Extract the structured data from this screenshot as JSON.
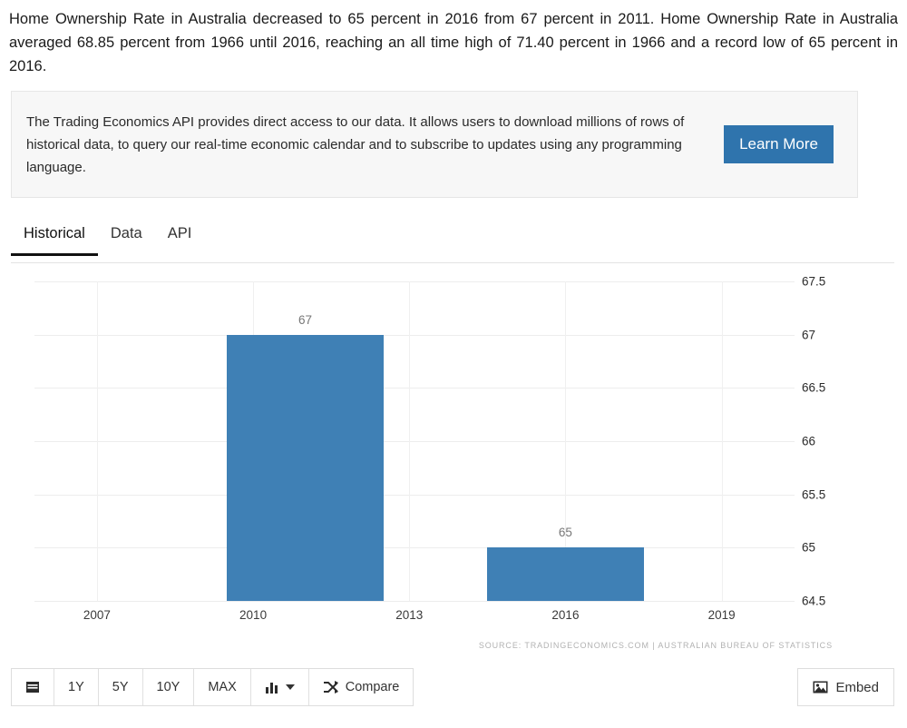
{
  "intro": {
    "paragraph": "Home Ownership Rate in Australia decreased to 65 percent in 2016 from 67 percent in 2011. Home Ownership Rate in Australia averaged 68.85 percent from 1966 until 2016, reaching an all time high of 71.40 percent in 1966 and a record low of 65 percent in 2016."
  },
  "api_card": {
    "text": "The Trading Economics API provides direct access to our data. It allows users to download millions of rows of historical data, to query our real-time economic calendar and to subscribe to updates using any programming language.",
    "button_label": "Learn More",
    "button_color": "#2f74ad"
  },
  "tabs": [
    {
      "label": "Historical",
      "active": true
    },
    {
      "label": "Data",
      "active": false
    },
    {
      "label": "API",
      "active": false
    }
  ],
  "chart_data": {
    "type": "bar",
    "title": "",
    "subtitle": "",
    "xlabel": "",
    "ylabel": "",
    "categories": [
      "2011",
      "2016"
    ],
    "values": [
      67,
      65
    ],
    "data_labels": [
      "67",
      "65"
    ],
    "series": [
      {
        "name": "Home Ownership Rate in Australia",
        "values": [
          67,
          65
        ]
      }
    ],
    "bar_color": "#3f80b5",
    "ylim": [
      64.5,
      67.5
    ],
    "yticks": [
      "67.5",
      "67",
      "66.5",
      "66",
      "65.5",
      "65",
      "64.5"
    ],
    "ytick_values": [
      67.5,
      67,
      66.5,
      66,
      65.5,
      65,
      64.5
    ],
    "xticks": [
      "2007",
      "2010",
      "2013",
      "2016",
      "2019"
    ],
    "xtick_values": [
      2007,
      2010,
      2013,
      2016,
      2019
    ],
    "xlim": [
      2005.8,
      2020.4
    ],
    "grid": true,
    "legend": "none",
    "source": "SOURCE: TRADINGECONOMICS.COM | AUSTRALIAN BUREAU OF STATISTICS"
  },
  "toolbar": {
    "calendar_label": "",
    "ranges": [
      "1Y",
      "5Y",
      "10Y",
      "MAX"
    ],
    "chart_type_label": "",
    "compare_label": "Compare",
    "embed_label": "Embed"
  }
}
